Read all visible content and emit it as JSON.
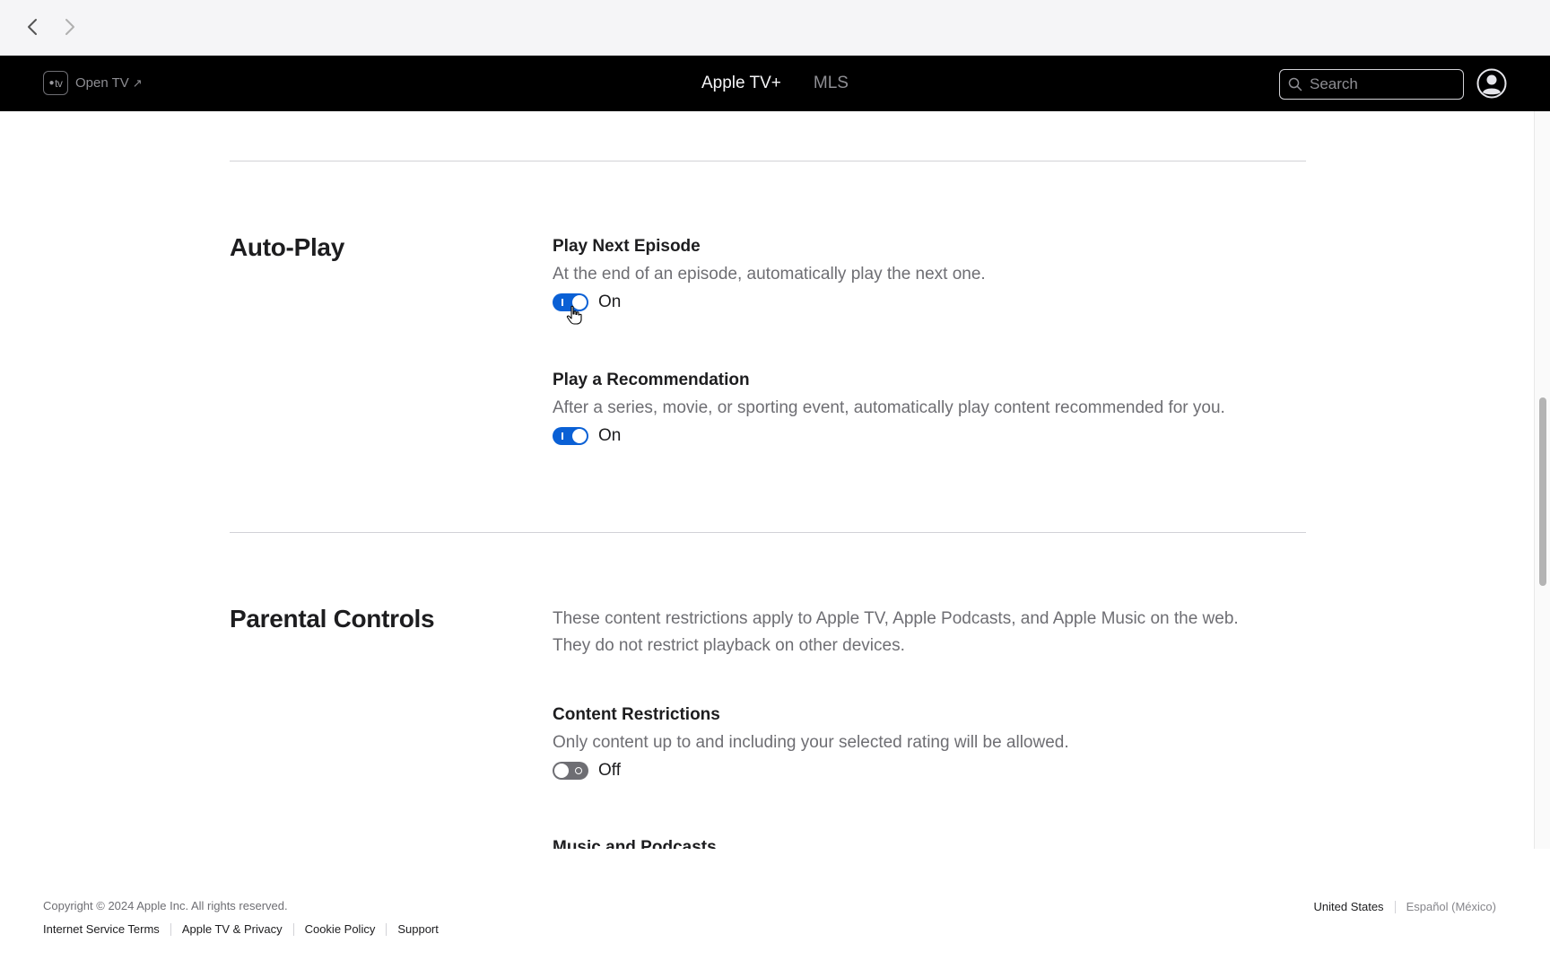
{
  "browser": {
    "back_icon": "chevron-left-icon",
    "forward_icon": "chevron-right-icon"
  },
  "topnav": {
    "open_tv_label": "Open TV",
    "open_tv_badge": "tv",
    "open_tv_arrow": "↗",
    "tabs": [
      {
        "label": "Apple TV+",
        "active": true
      },
      {
        "label": "MLS",
        "active": false
      }
    ],
    "search_placeholder": "Search"
  },
  "sections": {
    "autoplay": {
      "title": "Auto-Play",
      "settings": [
        {
          "title": "Play Next Episode",
          "description": "At the end of an episode, automatically play the next one.",
          "state": "On"
        },
        {
          "title": "Play a Recommendation",
          "description": "After a series, movie, or sporting event, automatically play content recommended for you.",
          "state": "On"
        }
      ]
    },
    "parental": {
      "title": "Parental Controls",
      "description_line1": "These content restrictions apply to Apple TV, Apple Podcasts, and Apple Music on the web.",
      "description_line2": "They do not restrict playback on other devices.",
      "settings": [
        {
          "title": "Content Restrictions",
          "description": "Only content up to and including your selected rating will be allowed.",
          "state": "Off"
        },
        {
          "title": "Music and Podcasts"
        }
      ]
    }
  },
  "footer": {
    "copyright": "Copyright © 2024 Apple Inc. All rights reserved.",
    "links": [
      "Internet Service Terms",
      "Apple TV & Privacy",
      "Cookie Policy",
      "Support"
    ],
    "country": "United States",
    "language": "Español (México)"
  },
  "colors": {
    "toggle_on": "#0a60d5",
    "toggle_off": "#6e6e73",
    "nav_background": "#000000"
  }
}
